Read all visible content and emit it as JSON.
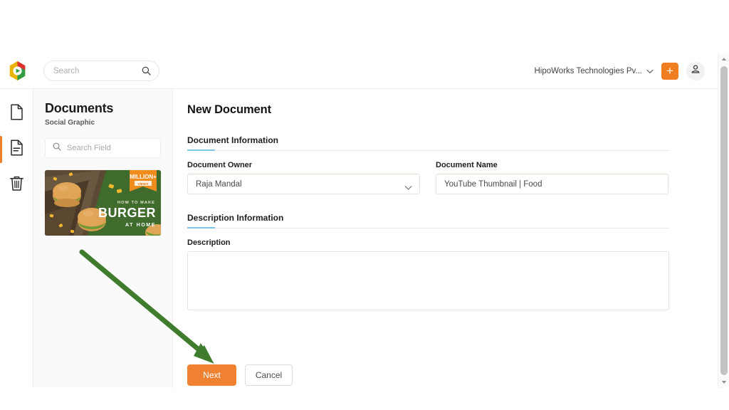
{
  "header": {
    "logo_icon": "hipoworks-hexagon-logo",
    "search": {
      "placeholder": "Search",
      "value": "",
      "icon": "search-icon"
    },
    "org_name": "HipoWorks Technologies Pv...",
    "org_chevron_icon": "chevron-down-icon",
    "add_button_label": "+",
    "add_button_icon": "plus-icon",
    "account_icon": "user-account-icon"
  },
  "rail": {
    "items": [
      {
        "name": "documents",
        "icon": "file-blank-icon",
        "active": false
      },
      {
        "name": "templates",
        "icon": "file-lines-icon",
        "active": true
      },
      {
        "name": "trash",
        "icon": "trash-icon",
        "active": false
      }
    ]
  },
  "doc_panel": {
    "title": "Documents",
    "subtitle": "Social Graphic",
    "search": {
      "placeholder": "Search Field",
      "value": "",
      "icon": "search-icon"
    },
    "thumbnail": {
      "name": "burger-thumbnail",
      "headline_small": "HOW TO MAKE",
      "headline_big": "BURGER",
      "headline_sub": "AT HOME",
      "ribbon_top": "MILLION+",
      "ribbon_bottom": "VIEWS",
      "bg_color": "#3f6b2c"
    }
  },
  "main": {
    "page_title": "New Document",
    "sections": [
      {
        "title": "Document Information",
        "fields": [
          {
            "label": "Document Owner",
            "type": "select",
            "value": "Raja Mandal",
            "placeholder": "",
            "icon": "chevron-down-icon"
          },
          {
            "label": "Document Name",
            "type": "text",
            "value": "YouTube Thumbnail | Food",
            "placeholder": ""
          }
        ]
      },
      {
        "title": "Description Information",
        "fields": [
          {
            "label": "Description",
            "type": "textarea",
            "value": "",
            "placeholder": ""
          }
        ]
      }
    ],
    "actions": {
      "next_label": "Next",
      "cancel_label": "Cancel"
    }
  },
  "scrollbar": {
    "up_icon": "scroll-up-arrow-icon",
    "down_icon": "scroll-down-arrow-icon"
  },
  "annotation": {
    "arrow_icon": "green-pointer-arrow",
    "color": "#3f7c2e"
  },
  "colors": {
    "accent_orange": "#ef8131",
    "section_underline": "#7cc7e8",
    "panel_bg": "#fafafa",
    "annotation_green": "#3f7c2e"
  }
}
